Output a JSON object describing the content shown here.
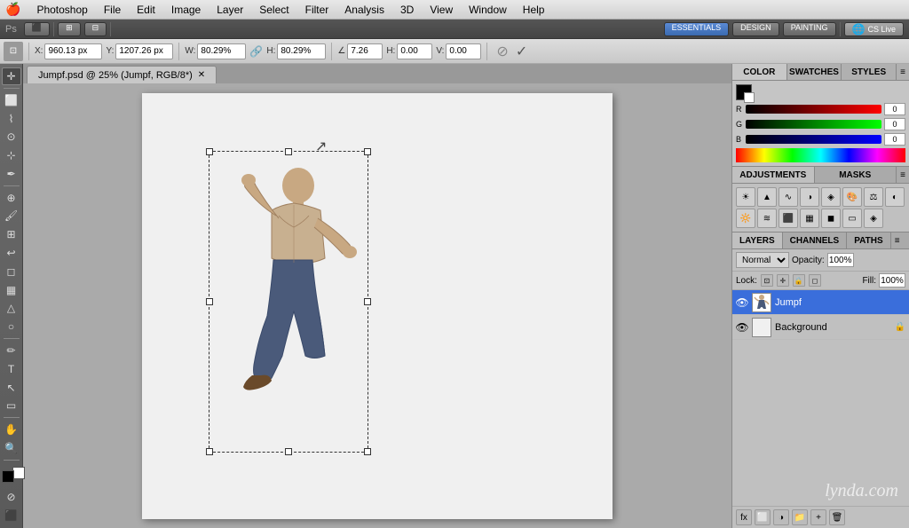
{
  "menubar": {
    "apple": "🍎",
    "items": [
      "Photoshop",
      "File",
      "Edit",
      "Image",
      "Layer",
      "Select",
      "Filter",
      "Analysis",
      "3D",
      "View",
      "Window",
      "Help"
    ]
  },
  "workspace_header": {
    "buttons": [
      "ESSENTIALS",
      "DESIGN",
      "PAINTING"
    ],
    "active": "ESSENTIALS",
    "cs_live": "CS Live"
  },
  "optionsbar": {
    "x_label": "X:",
    "x_value": "960.13 px",
    "y_label": "Y:",
    "y_value": "1207.26 px",
    "w_label": "W:",
    "w_value": "80.29%",
    "h_label": "H:",
    "h_value": "80.29%",
    "angle_value": "7.26",
    "h_skew": "0.00",
    "v_skew": "0.00"
  },
  "color_panel": {
    "tabs": [
      "COLOR",
      "SWATCHES",
      "STYLES"
    ],
    "active_tab": "COLOR",
    "r_value": "0",
    "g_value": "0",
    "b_value": "0"
  },
  "adjustments_panel": {
    "tabs": [
      "ADJUSTMENTS",
      "MASKS"
    ],
    "active_tab": "ADJUSTMENTS"
  },
  "layers_panel": {
    "tabs": [
      "LAYERS",
      "CHANNELS",
      "PATHS"
    ],
    "active_tab": "LAYERS",
    "blend_mode": "Normal",
    "opacity_label": "Opacity:",
    "opacity_value": "100%",
    "lock_label": "Lock:",
    "fill_label": "Fill:",
    "fill_value": "100%",
    "layers": [
      {
        "name": "Jumpf",
        "visible": true,
        "active": true,
        "type": "image"
      },
      {
        "name": "Background",
        "visible": true,
        "active": false,
        "type": "background"
      }
    ]
  },
  "canvas": {
    "tab_name": "Jumpf.psd @ 25% (Jumpf, RGB/8*)",
    "document_size": "25%"
  },
  "lynda_watermark": "lynda.com"
}
